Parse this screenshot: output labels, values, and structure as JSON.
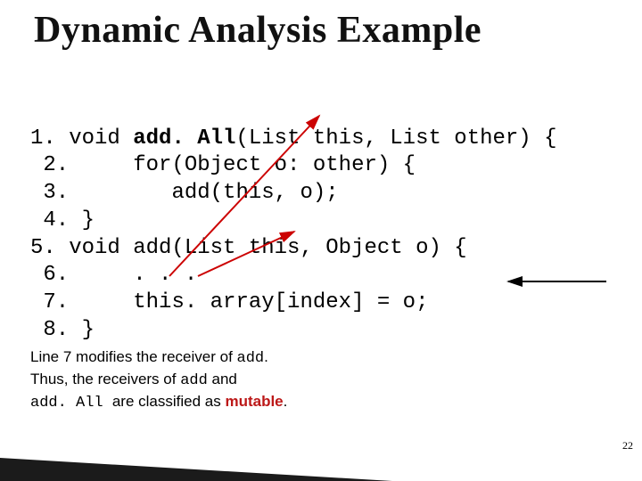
{
  "title": "Dynamic Analysis Example",
  "code": {
    "l1": {
      "num": "1.",
      "pre": " void ",
      "bold": "add. All",
      "post": "(List this, List other) {"
    },
    "l2": {
      "num": " 2.",
      "txt": "     for(Object o: other) {"
    },
    "l3": {
      "num": " 3.",
      "txt": "        add(this, o);"
    },
    "l4": {
      "num": " 4.",
      "txt": " }"
    },
    "l5": {
      "num": "5.",
      "txt": " void add(List this, Object o) {"
    },
    "l6": {
      "num": " 6.",
      "txt": "     . . ."
    },
    "l7": {
      "num": " 7.",
      "txt": "     this. array[index] = o;"
    },
    "l8": {
      "num": " 8.",
      "txt": " }"
    }
  },
  "caption": {
    "l1a": "Line 7 modifies the receiver of ",
    "l1m": "add",
    "l1b": ".",
    "l2a": "Thus, the receivers of ",
    "l2m1": "add",
    "l2b": " and",
    "l3m": "add. All ",
    "l3a": " are classified as ",
    "l3mut": "mutable",
    "l3b": "."
  },
  "pagenum": "22"
}
